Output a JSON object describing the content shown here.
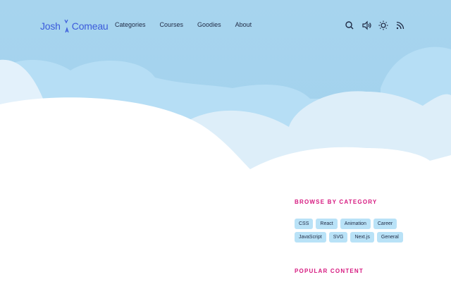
{
  "logo": {
    "first": "Josh",
    "last": "Comeau"
  },
  "nav": {
    "items": [
      "Categories",
      "Courses",
      "Goodies",
      "About"
    ]
  },
  "toolbar": {
    "icons": [
      "search-icon",
      "volume-icon",
      "sun-icon",
      "rss-icon"
    ]
  },
  "sidebar": {
    "browse_title": "Browse by Category",
    "categories": [
      "CSS",
      "React",
      "Animation",
      "Career",
      "JavaScript",
      "SVG",
      "Next.js",
      "General"
    ],
    "popular_title": "Popular Content"
  },
  "colors": {
    "sky": "#a7d4ee",
    "cloud_far": "#b8e0f6",
    "cloud_mid": "#ddeef9",
    "brand": "#3b5bdb",
    "accent": "#d6187f",
    "tag_bg": "#b9e2f7"
  }
}
